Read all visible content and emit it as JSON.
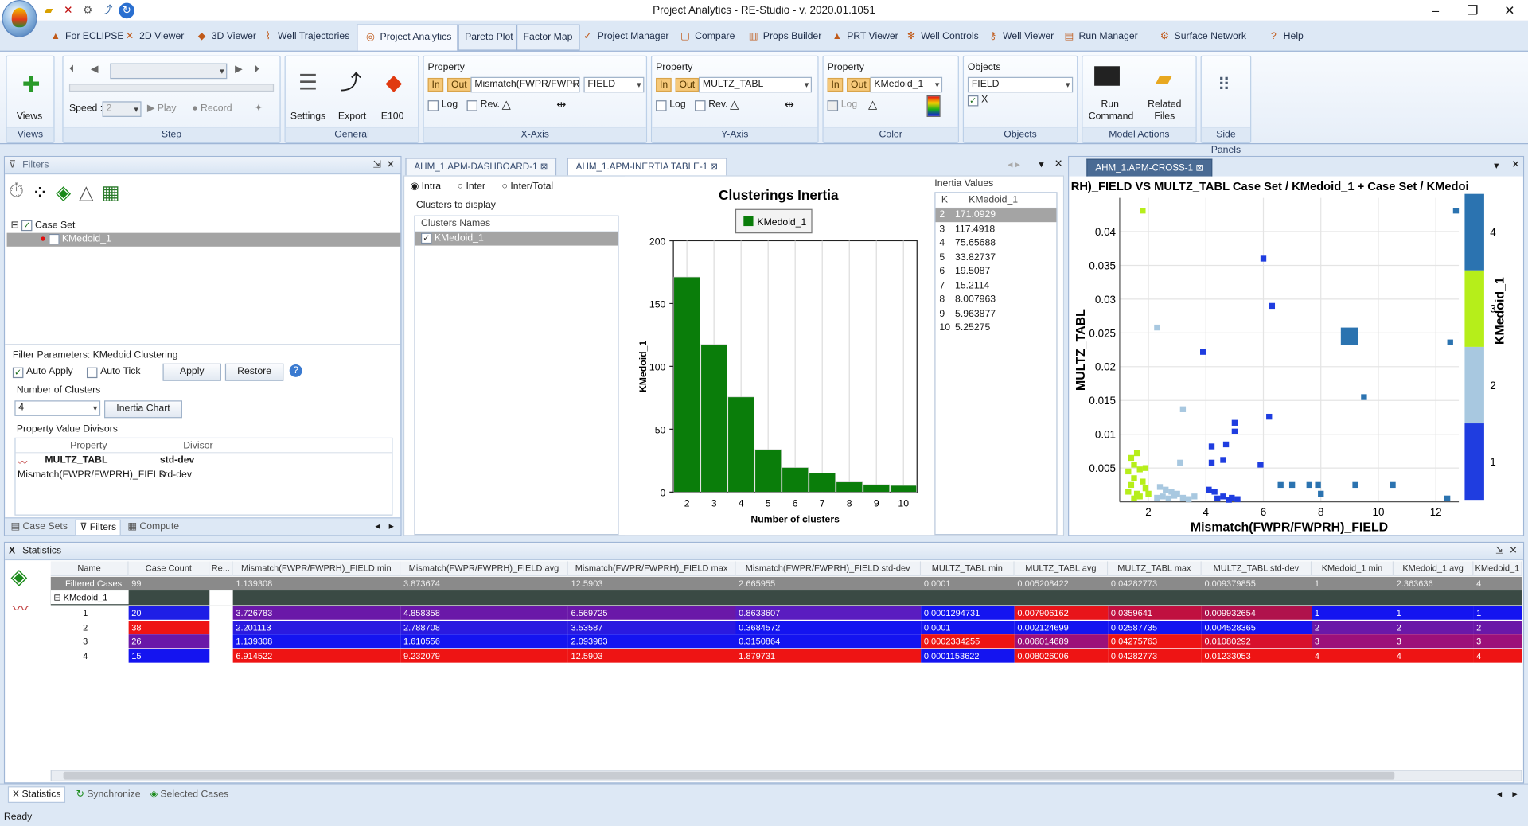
{
  "window": {
    "title": "Project Analytics - RE-Studio - v. 2020.01.1051"
  },
  "nav_tabs": [
    {
      "label": "For ECLIPSE",
      "icon": "eclipse-icon"
    },
    {
      "label": "2D Viewer",
      "icon": "2d-viewer-icon"
    },
    {
      "label": "3D Viewer",
      "icon": "3d-viewer-icon"
    },
    {
      "label": "Well Trajectories",
      "icon": "well-trajectories-icon"
    },
    {
      "label": "Project Analytics",
      "icon": "project-analytics-icon"
    },
    {
      "label": "Pareto Plot",
      "icon": ""
    },
    {
      "label": "Factor Map",
      "icon": ""
    },
    {
      "label": "Project Manager",
      "icon": "project-manager-icon"
    },
    {
      "label": "Compare",
      "icon": "compare-icon"
    },
    {
      "label": "Props Builder",
      "icon": "props-builder-icon"
    },
    {
      "label": "PRT Viewer",
      "icon": "prt-viewer-icon"
    },
    {
      "label": "Well Controls",
      "icon": "well-controls-icon"
    },
    {
      "label": "Well Viewer",
      "icon": "well-viewer-icon"
    },
    {
      "label": "Run Manager",
      "icon": "run-manager-icon"
    },
    {
      "label": "Surface Network",
      "icon": "surface-network-icon"
    },
    {
      "label": "Help",
      "icon": "help-icon"
    }
  ],
  "ribbon": {
    "views": {
      "label": "Views",
      "group": "Views"
    },
    "step": {
      "speed_label": "Speed :",
      "speed_value": "2",
      "play": "Play",
      "record": "Record",
      "group": "Step"
    },
    "general": {
      "settings": "Settings",
      "export": "Export",
      "e100": "E100",
      "group": "General"
    },
    "xaxis": {
      "property_label": "Property",
      "in": "In",
      "out": "Out",
      "property": "Mismatch(FWPR/FWPR",
      "object": "FIELD",
      "log": "Log",
      "rev": "Rev.",
      "group": "X-Axis"
    },
    "yaxis": {
      "property_label": "Property",
      "in": "In",
      "out": "Out",
      "property": "MULTZ_TABL",
      "log": "Log",
      "rev": "Rev.",
      "group": "Y-Axis"
    },
    "color": {
      "property_label": "Property",
      "in": "In",
      "out": "Out",
      "property": "KMedoid_1",
      "log": "Log",
      "group": "Color"
    },
    "objects": {
      "label": "Objects",
      "value": "FIELD",
      "x_label": "X",
      "group": "Objects"
    },
    "model_actions": {
      "run_command": "Run Command",
      "related_files": "Related Files",
      "group": "Model Actions"
    },
    "side_panels": {
      "group": "Side Panels"
    }
  },
  "filters_panel": {
    "title": "Filters",
    "tree": [
      {
        "label": "Case Set",
        "checked": true
      },
      {
        "label": "KMedoid_1",
        "checked": false
      }
    ],
    "params_title": "Filter Parameters: KMedoid Clustering",
    "auto_apply": "Auto Apply",
    "auto_tick": "Auto Tick",
    "apply": "Apply",
    "restore": "Restore",
    "num_clusters_label": "Number of Clusters",
    "num_clusters": "4",
    "inertia_chart": "Inertia Chart",
    "divisors_label": "Property Value Divisors",
    "divisor_headers": [
      "Property",
      "Divisor"
    ],
    "divisors": [
      {
        "property": "MULTZ_TABL",
        "divisor": "std-dev"
      },
      {
        "property": "Mismatch(FWPR/FWPRH)_FIELD",
        "divisor": "std-dev"
      }
    ],
    "bottom_tabs": [
      "Case Sets",
      "Filters",
      "Compute"
    ]
  },
  "doc_tabs": [
    "AHM_1.APM-DASHBOARD-1",
    "AHM_1.APM-INERTIA TABLE-1"
  ],
  "inertia": {
    "radio": [
      "Intra",
      "Inter",
      "Inter/Total"
    ],
    "clusters_label": "Clusters to display",
    "clusters_header": "Clusters Names",
    "clusters": [
      "KMedoid_1"
    ],
    "values_title": "Inertia Values",
    "values_headers": [
      "K",
      "KMedoid_1"
    ],
    "values": [
      {
        "k": "2",
        "v": "171.0929"
      },
      {
        "k": "3",
        "v": "117.4918"
      },
      {
        "k": "4",
        "v": "75.65688"
      },
      {
        "k": "5",
        "v": "33.82737"
      },
      {
        "k": "6",
        "v": "19.5087"
      },
      {
        "k": "7",
        "v": "15.2114"
      },
      {
        "k": "8",
        "v": "8.007963"
      },
      {
        "k": "9",
        "v": "5.963877"
      },
      {
        "k": "10",
        "v": "5.25275"
      }
    ]
  },
  "cross_tab": "AHM_1.APM-CROSS-1",
  "chart_data": [
    {
      "type": "bar",
      "title": "Clusterings Inertia",
      "legend": [
        "KMedoid_1"
      ],
      "xlabel": "Number of clusters",
      "ylabel": "KMedoid_1",
      "categories": [
        "2",
        "3",
        "4",
        "5",
        "6",
        "7",
        "8",
        "9",
        "10"
      ],
      "values": [
        171.0929,
        117.4918,
        75.65688,
        33.82737,
        19.5087,
        15.2114,
        8.007963,
        5.963877,
        5.25275
      ],
      "ylim": [
        0,
        200
      ],
      "yticks": [
        0,
        50,
        100,
        150,
        200
      ],
      "color": "#0a7d0a"
    },
    {
      "type": "scatter",
      "title": "RH)_FIELD VS MULTZ_TABL      Case Set / KMedoid_1  +  Case Set / KMedoi",
      "xlabel": "Mismatch(FWPR/FWPRH)_FIELD",
      "ylabel": "MULTZ_TABL",
      "colorbar_label": "KMedoid_1",
      "xlim": [
        1,
        12.8
      ],
      "ylim": [
        0,
        0.045
      ],
      "xticks": [
        2,
        4,
        6,
        8,
        10,
        12
      ],
      "yticks": [
        0.005,
        0.01,
        0.015,
        0.02,
        0.025,
        0.03,
        0.035,
        0.04
      ],
      "cluster_colors": {
        "1": "#1f3de0",
        "2": "#a8c8e0",
        "3": "#b6ee1a",
        "4": "#2b73b0"
      },
      "colorbar_ticks": [
        "1",
        "2",
        "3",
        "4"
      ],
      "points": [
        {
          "x": 1.8,
          "y": 0.0431,
          "c": 3
        },
        {
          "x": 1.4,
          "y": 0.0065,
          "c": 3
        },
        {
          "x": 1.5,
          "y": 0.0055,
          "c": 3
        },
        {
          "x": 1.7,
          "y": 0.0048,
          "c": 3
        },
        {
          "x": 1.9,
          "y": 0.005,
          "c": 3
        },
        {
          "x": 1.3,
          "y": 0.0045,
          "c": 3
        },
        {
          "x": 1.6,
          "y": 0.0072,
          "c": 3
        },
        {
          "x": 1.5,
          "y": 0.0035,
          "c": 3
        },
        {
          "x": 1.8,
          "y": 0.003,
          "c": 3
        },
        {
          "x": 1.4,
          "y": 0.0025,
          "c": 3
        },
        {
          "x": 1.6,
          "y": 0.0012,
          "c": 3
        },
        {
          "x": 1.9,
          "y": 0.002,
          "c": 3
        },
        {
          "x": 1.3,
          "y": 0.0015,
          "c": 3
        },
        {
          "x": 1.7,
          "y": 0.0008,
          "c": 3
        },
        {
          "x": 2.0,
          "y": 0.0012,
          "c": 3
        },
        {
          "x": 1.5,
          "y": 0.0005,
          "c": 3
        },
        {
          "x": 2.3,
          "y": 0.0258,
          "c": 2
        },
        {
          "x": 3.2,
          "y": 0.0137,
          "c": 2
        },
        {
          "x": 3.1,
          "y": 0.0058,
          "c": 2
        },
        {
          "x": 2.4,
          "y": 0.0022,
          "c": 2
        },
        {
          "x": 2.6,
          "y": 0.0018,
          "c": 2
        },
        {
          "x": 2.8,
          "y": 0.0015,
          "c": 2
        },
        {
          "x": 3.0,
          "y": 0.0012,
          "c": 2
        },
        {
          "x": 2.5,
          "y": 0.0008,
          "c": 2
        },
        {
          "x": 2.7,
          "y": 0.0005,
          "c": 2
        },
        {
          "x": 2.9,
          "y": 0.0009,
          "c": 2
        },
        {
          "x": 3.2,
          "y": 0.0006,
          "c": 2
        },
        {
          "x": 3.4,
          "y": 0.0004,
          "c": 2
        },
        {
          "x": 2.3,
          "y": 0.0006,
          "c": 2
        },
        {
          "x": 3.6,
          "y": 0.0008,
          "c": 2
        },
        {
          "x": 6.0,
          "y": 0.036,
          "c": 1
        },
        {
          "x": 6.3,
          "y": 0.029,
          "c": 1
        },
        {
          "x": 3.9,
          "y": 0.0222,
          "c": 1
        },
        {
          "x": 6.2,
          "y": 0.0126,
          "c": 1
        },
        {
          "x": 5.0,
          "y": 0.0117,
          "c": 1
        },
        {
          "x": 5.0,
          "y": 0.0104,
          "c": 1
        },
        {
          "x": 4.2,
          "y": 0.0082,
          "c": 1
        },
        {
          "x": 4.7,
          "y": 0.0085,
          "c": 1
        },
        {
          "x": 5.9,
          "y": 0.0055,
          "c": 1
        },
        {
          "x": 4.2,
          "y": 0.0058,
          "c": 1
        },
        {
          "x": 4.6,
          "y": 0.0062,
          "c": 1
        },
        {
          "x": 4.3,
          "y": 0.0015,
          "c": 1
        },
        {
          "x": 4.6,
          "y": 0.0008,
          "c": 1
        },
        {
          "x": 4.9,
          "y": 0.0006,
          "c": 1
        },
        {
          "x": 4.4,
          "y": 0.0005,
          "c": 1
        },
        {
          "x": 5.1,
          "y": 0.0004,
          "c": 1
        },
        {
          "x": 4.1,
          "y": 0.0018,
          "c": 1
        },
        {
          "x": 4.8,
          "y": 0.0003,
          "c": 1
        },
        {
          "x": 9.5,
          "y": 0.0155,
          "c": 4
        },
        {
          "x": 12.5,
          "y": 0.0236,
          "c": 4
        },
        {
          "x": 12.7,
          "y": 0.0431,
          "c": 4
        },
        {
          "x": 10.5,
          "y": 0.0025,
          "c": 4
        },
        {
          "x": 9.2,
          "y": 0.0025,
          "c": 4
        },
        {
          "x": 7.9,
          "y": 0.0025,
          "c": 4
        },
        {
          "x": 7.0,
          "y": 0.0025,
          "c": 4
        },
        {
          "x": 7.6,
          "y": 0.0025,
          "c": 4
        },
        {
          "x": 6.6,
          "y": 0.0025,
          "c": 4
        },
        {
          "x": 8.0,
          "y": 0.0012,
          "c": 4
        },
        {
          "x": 12.4,
          "y": 0.0005,
          "c": 4
        },
        {
          "x": 9.0,
          "y": 0.0245,
          "c": 4,
          "big": true
        }
      ]
    }
  ],
  "statistics": {
    "title": "Statistics",
    "headers": [
      "Name",
      "Case Count",
      "Re...",
      "Mismatch(FWPR/FWPRH)_FIELD min",
      "Mismatch(FWPR/FWPRH)_FIELD avg",
      "Mismatch(FWPR/FWPRH)_FIELD max",
      "Mismatch(FWPR/FWPRH)_FIELD std-dev",
      "MULTZ_TABL min",
      "MULTZ_TABL avg",
      "MULTZ_TABL max",
      "MULTZ_TABL std-dev",
      "KMedoid_1 min",
      "KMedoid_1 avg",
      "KMedoid_1"
    ],
    "filtered": {
      "name": "Filtered Cases",
      "cells": [
        "99",
        "",
        "1.139308",
        "3.873674",
        "12.5903",
        "2.665955",
        "0.0001",
        "0.005208422",
        "0.04282773",
        "0.009379855",
        "1",
        "2.363636",
        "4"
      ]
    },
    "group": "KMedoid_1",
    "rows": [
      {
        "name": "1",
        "cells": [
          "20",
          "",
          "3.726783",
          "4.858358",
          "6.569725",
          "0.8633607",
          "0.0001294731",
          "0.007906162",
          "0.0359641",
          "0.009932654",
          "1",
          "1",
          "1"
        ],
        "colors": [
          "#1e1ee6",
          "",
          "#6a18a8",
          "#6a18a8",
          "#6a18a8",
          "#5a1cc0",
          "#1414f0",
          "#e8141a",
          "#c01040",
          "#b0124c",
          "#1414f0",
          "#1414f0",
          "#1414f0"
        ]
      },
      {
        "name": "2",
        "cells": [
          "38",
          "",
          "2.201113",
          "2.788708",
          "3.53587",
          "0.3684572",
          "0.0001",
          "0.002124699",
          "0.02587735",
          "0.004528365",
          "2",
          "2",
          "2"
        ],
        "colors": [
          "#ee1414",
          "",
          "#2a1ae0",
          "#2a1ae0",
          "#2a1ae0",
          "#1414f0",
          "#1414f0",
          "#1414f0",
          "#1414f0",
          "#1414f0",
          "#6a18a8",
          "#6a18a8",
          "#6a18a8"
        ]
      },
      {
        "name": "3",
        "cells": [
          "26",
          "",
          "1.139308",
          "1.610556",
          "2.093983",
          "0.3150864",
          "0.0002334255",
          "0.006014689",
          "0.04275763",
          "0.01080292",
          "3",
          "3",
          "3"
        ],
        "colors": [
          "#6a18a8",
          "",
          "#1414f0",
          "#1414f0",
          "#1414f0",
          "#1414f0",
          "#ee1414",
          "#9c107a",
          "#ee1414",
          "#d8102c",
          "#9c107a",
          "#9c107a",
          "#9c107a"
        ]
      },
      {
        "name": "4",
        "cells": [
          "15",
          "",
          "6.914522",
          "9.232079",
          "12.5903",
          "1.879731",
          "0.0001153622",
          "0.008026006",
          "0.04282773",
          "0.01233053",
          "4",
          "4",
          "4"
        ],
        "colors": [
          "#1414f0",
          "",
          "#ee1414",
          "#ee1414",
          "#ee1414",
          "#ee1414",
          "#1414f0",
          "#ee1414",
          "#ee1414",
          "#ee1414",
          "#ee1414",
          "#ee1414",
          "#ee1414"
        ]
      }
    ]
  },
  "bottom_tabs": [
    "Statistics",
    "Synchronize",
    "Selected Cases"
  ],
  "status": "Ready"
}
